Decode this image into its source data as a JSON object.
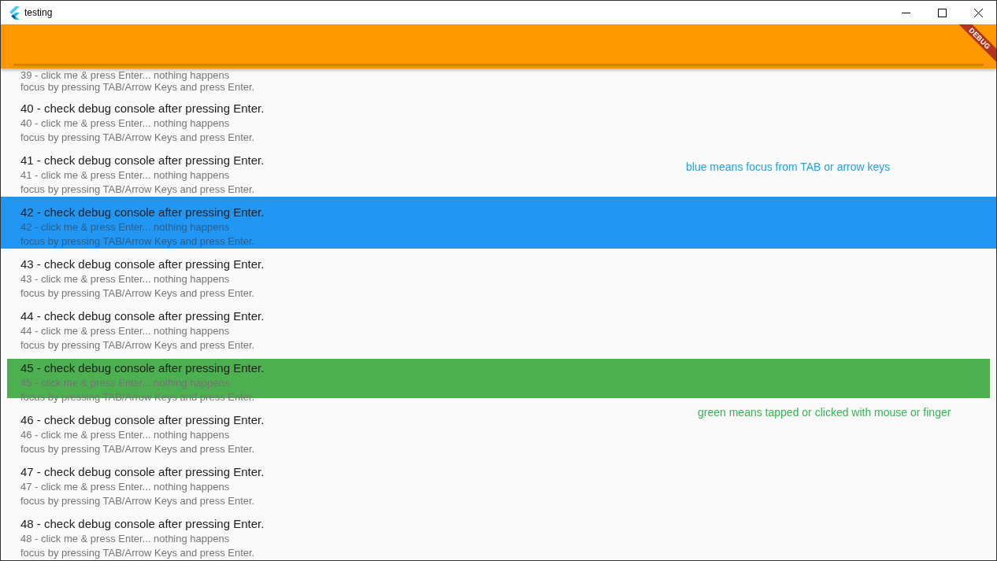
{
  "window": {
    "title": "testing"
  },
  "debug_banner": "DEBUG",
  "rows": [
    {
      "subtitle": "39 - click me & press Enter... nothing happens",
      "hint": "focus by pressing TAB/Arrow Keys and press Enter.",
      "focused": false,
      "tapped": false
    },
    {
      "title": "40 - check debug console after pressing Enter.",
      "subtitle": "40 - click me & press Enter... nothing happens",
      "hint": "focus by pressing TAB/Arrow Keys and press Enter.",
      "focused": false,
      "tapped": false
    },
    {
      "title": "41 - check debug console after pressing Enter.",
      "subtitle": "41 - click me & press Enter... nothing happens",
      "hint": "focus by pressing TAB/Arrow Keys and press Enter.",
      "focused": false,
      "tapped": false
    },
    {
      "title": "42 - check debug console after pressing Enter.",
      "subtitle": "42 - click me & press Enter... nothing happens",
      "hint": "focus by pressing TAB/Arrow Keys and press Enter.",
      "focused": true,
      "tapped": false
    },
    {
      "title": "43 - check debug console after pressing Enter.",
      "subtitle": "43 - click me & press Enter... nothing happens",
      "hint": "focus by pressing TAB/Arrow Keys and press Enter.",
      "focused": false,
      "tapped": false
    },
    {
      "title": "44 - check debug console after pressing Enter.",
      "subtitle": "44 - click me & press Enter... nothing happens",
      "hint": "focus by pressing TAB/Arrow Keys and press Enter.",
      "focused": false,
      "tapped": false
    },
    {
      "title": "45 - check debug console after pressing Enter.",
      "subtitle": "45 - click me & press Enter... nothing happens",
      "hint": "focus by pressing TAB/Arrow Keys and press Enter.",
      "focused": false,
      "tapped": true
    },
    {
      "title": "46 - check debug console after pressing Enter.",
      "subtitle": "46 - click me & press Enter... nothing happens",
      "hint": "focus by pressing TAB/Arrow Keys and press Enter.",
      "focused": false,
      "tapped": false
    },
    {
      "title": "47 - check debug console after pressing Enter.",
      "subtitle": "47 - click me & press Enter... nothing happens",
      "hint": "focus by pressing TAB/Arrow Keys and press Enter.",
      "focused": false,
      "tapped": false
    },
    {
      "title": "48 - check debug console after pressing Enter.",
      "subtitle": "48 - click me & press Enter... nothing happens",
      "hint": "focus by pressing TAB/Arrow Keys and press Enter.",
      "focused": false,
      "tapped": false
    }
  ],
  "notes": [
    {
      "text": "blue means focus from TAB or arrow keys",
      "color": "#1fa2e6"
    },
    {
      "text": "green means tapped or clicked with mouse or finger",
      "color": "#2fb84e"
    }
  ]
}
